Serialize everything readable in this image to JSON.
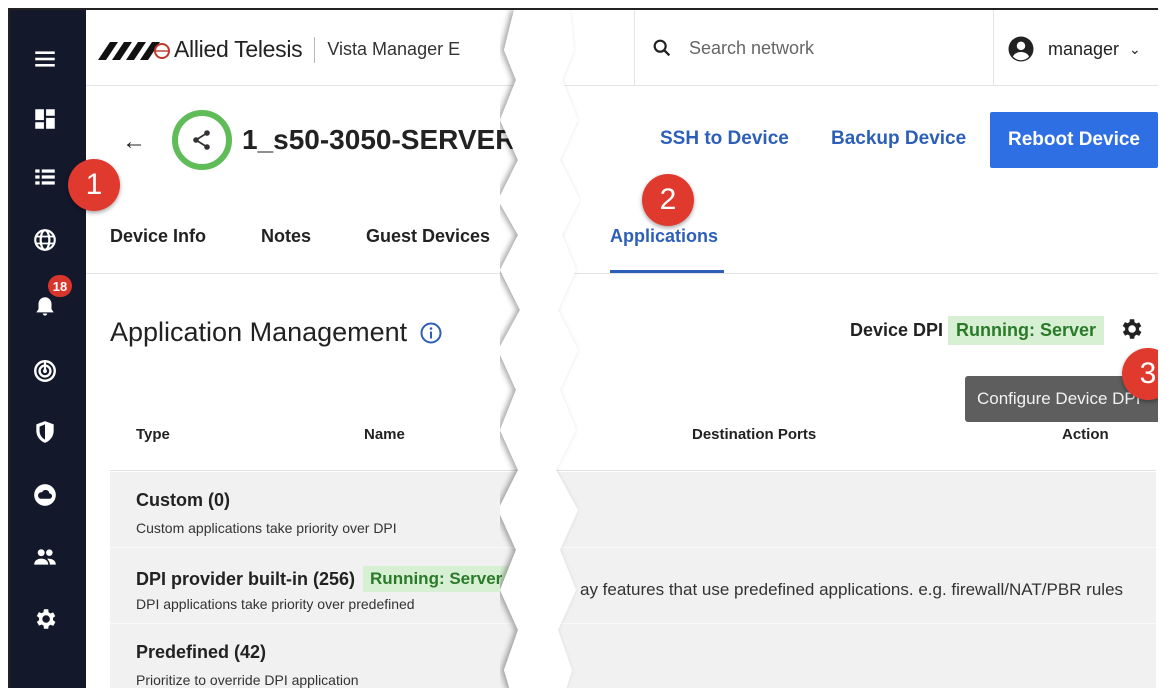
{
  "topbar": {
    "brand": "Allied Telesis",
    "product": "Vista Manager E",
    "search_placeholder": "Search network",
    "user": "manager",
    "user_caret": "⌄"
  },
  "sidebar": {
    "items": [
      {
        "icon": "menu-icon"
      },
      {
        "icon": "dashboard-icon"
      },
      {
        "icon": "list-icon"
      },
      {
        "icon": "globe-icon"
      },
      {
        "icon": "bell-icon",
        "badge": "18"
      },
      {
        "icon": "radar-icon"
      },
      {
        "icon": "shield-icon"
      },
      {
        "icon": "cloud-icon"
      },
      {
        "icon": "people-icon"
      },
      {
        "icon": "gear-icon"
      }
    ]
  },
  "device": {
    "back": "←",
    "name": "1_s50-3050-SERVER",
    "ssh": "SSH to Device",
    "backup": "Backup Device",
    "reboot": "Reboot Device",
    "status_color": "#5fbc58"
  },
  "tabs": [
    {
      "label": "Device Info"
    },
    {
      "label": "Notes"
    },
    {
      "label": "Guest Devices"
    },
    {
      "label": "Applications",
      "active": true
    }
  ],
  "app_mgmt": {
    "title": "Application Management",
    "dpi_label": "Device DPI",
    "dpi_status": "Running: Server",
    "tooltip": "Configure Device DPI"
  },
  "table": {
    "headers": {
      "type": "Type",
      "name": "Name",
      "ports": "Destination Ports",
      "action": "Action"
    },
    "rows": [
      {
        "title": "Custom (0)",
        "subtitle": "Custom applications take priority over DPI"
      },
      {
        "title": "DPI provider built-in (256)",
        "pill": "Running: Server",
        "subtitle": "DPI applications take priority over predefined",
        "desc": "ay features that use predefined applications. e.g. firewall/NAT/PBR rules"
      },
      {
        "title": "Predefined (42)",
        "subtitle": "Prioritize to override DPI application"
      }
    ]
  },
  "callouts": [
    "1",
    "2",
    "3"
  ],
  "colors": {
    "rail": "#13182b",
    "accent": "#2d5fb8",
    "button": "#2f6fe4",
    "callout": "#e03a2e",
    "pill_bg": "#d7f0d3"
  }
}
